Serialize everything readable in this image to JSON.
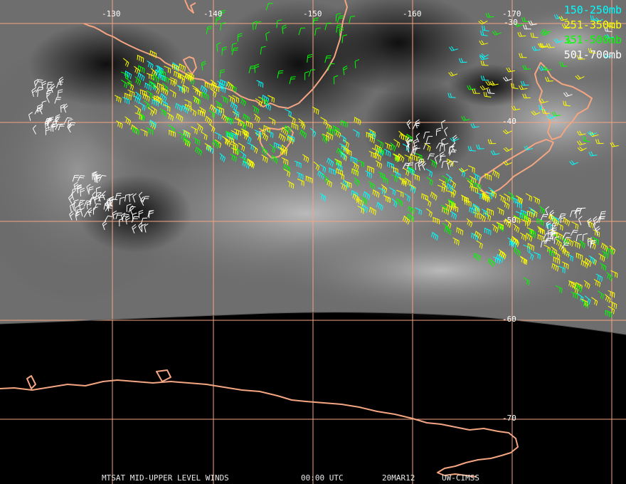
{
  "map": {
    "lon_labels": [
      "-130",
      "-140",
      "-150",
      "-160",
      "-170"
    ],
    "lat_labels": [
      "-30",
      "-40",
      "-50",
      "-60",
      "-70"
    ],
    "colors": {
      "gridline": "#f4a582",
      "coastline": "#f4a582",
      "background": "#000000"
    }
  },
  "legend": [
    {
      "label": "150-250mb",
      "color": "#00ffff"
    },
    {
      "label": "251-350mb",
      "color": "#ffff00"
    },
    {
      "label": "351-500mb",
      "color": "#00ff00"
    },
    {
      "label": "501-700mb",
      "color": "#ffffff"
    }
  ],
  "footer": {
    "product": "MTSAT MID-UPPER LEVEL WINDS",
    "time": "00:00 UTC",
    "date": "20MAR12",
    "credit": "UW-CIMSS"
  }
}
